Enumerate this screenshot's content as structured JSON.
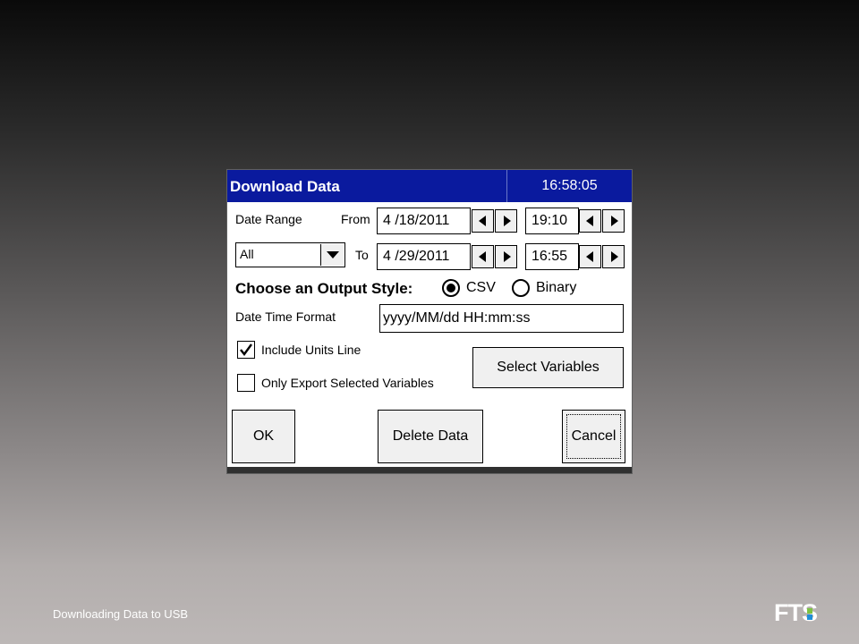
{
  "window": {
    "title": "Download Data",
    "clock": "16:58:05"
  },
  "date_range": {
    "label": "Date Range",
    "preset": "All",
    "from_label": "From",
    "to_label": "To",
    "from_date": "4 /18/2011",
    "from_time": "19:10",
    "to_date": "4 /29/2011",
    "to_time": "16:55"
  },
  "output_style": {
    "label": "Choose an Output Style:",
    "options": [
      "CSV",
      "Binary"
    ],
    "selected": "CSV"
  },
  "datetime_format": {
    "label": "Date Time Format",
    "value": "yyyy/MM/dd HH:mm:ss"
  },
  "options": {
    "include_units_label": "Include Units Line",
    "include_units_checked": true,
    "only_selected_label": "Only Export Selected Variables",
    "only_selected_checked": false
  },
  "buttons": {
    "select_variables": "Select Variables",
    "ok": "OK",
    "delete_data": "Delete Data",
    "cancel": "Cancel"
  },
  "footer": {
    "caption": "Downloading Data to USB",
    "logo_text": "FTS"
  },
  "colors": {
    "titlebar": "#0a1a9e",
    "logo_green": "#7dc243",
    "logo_blue": "#1f8fd6"
  }
}
